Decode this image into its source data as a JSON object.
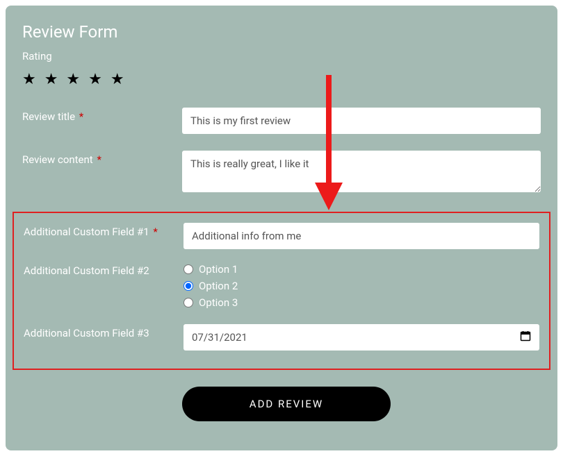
{
  "form": {
    "title": "Review Form",
    "rating_label": "Rating",
    "stars_count": 5,
    "review_title": {
      "label": "Review title",
      "required_marker": "*",
      "value": "This is my first review"
    },
    "review_content": {
      "label": "Review content",
      "required_marker": "*",
      "value": "This is really great, I like it"
    },
    "custom_field_1": {
      "label": "Additional Custom Field #1",
      "required_marker": "*",
      "value": "Additional info from me"
    },
    "custom_field_2": {
      "label": "Additional Custom Field #2",
      "options": [
        "Option 1",
        "Option 2",
        "Option 3"
      ],
      "selected_index": 1
    },
    "custom_field_3": {
      "label": "Additional Custom Field #3",
      "value": "07/31/2021"
    },
    "submit_label": "ADD REVIEW"
  },
  "annotations": {
    "arrow_color": "#ec1a1a",
    "highlight_box_color": "#df2020"
  }
}
